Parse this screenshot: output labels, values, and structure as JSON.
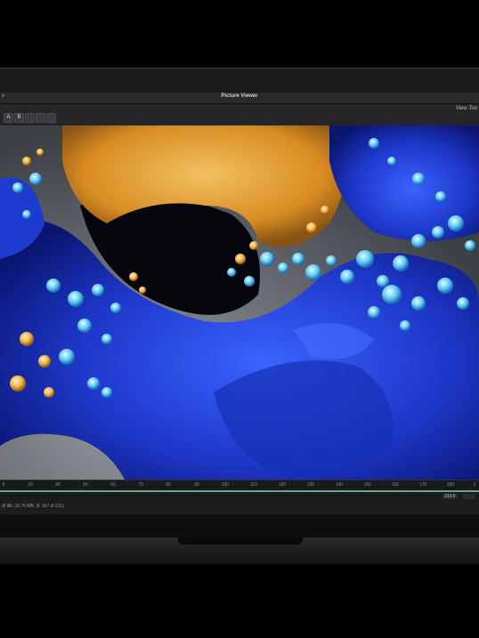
{
  "window": {
    "title": "Picture Viewer",
    "left_stub": "e",
    "view_tools_label": "View Too"
  },
  "toolbar": {
    "buttons": [
      "A",
      "B",
      "",
      "",
      ""
    ]
  },
  "timeline": {
    "ticks": [
      "0",
      "30",
      "40",
      "50",
      "60",
      "70",
      "80",
      "90",
      "100",
      "110",
      "120",
      "130",
      "140",
      "150",
      "160",
      "170",
      "180",
      "1"
    ],
    "frame_value": "210 F",
    "frame_extra": ""
  },
  "status": {
    "text": "(8 Bit, 16.76 MB, (F 167 of 211)"
  },
  "colors": {
    "background": "#000000",
    "window_bg": "#1f1f21",
    "accent_green": "#6ea87a",
    "art_blue": "#1f3fd1",
    "art_orange": "#e3a23a"
  }
}
